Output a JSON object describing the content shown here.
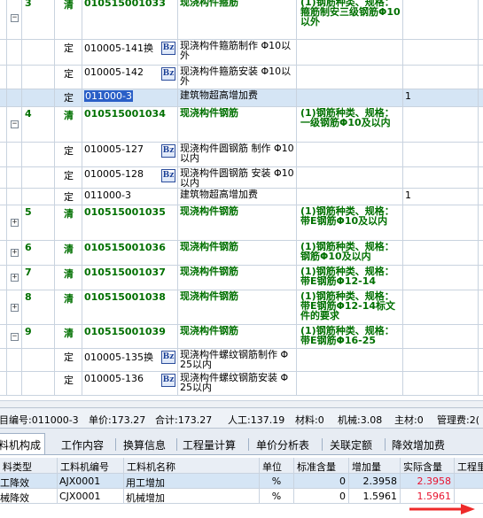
{
  "grid": {
    "rows": [
      {
        "type": "qing",
        "num": "3",
        "kind": "清",
        "code": "010515001033",
        "name": "现浇构件箍筋",
        "feature": "(1)钢筋种类、规格：箍筋制安三级钢筋Φ10以外",
        "qty": "",
        "toggle": "−"
      },
      {
        "type": "ding",
        "num": "",
        "kind": "定",
        "code": "010005-141换",
        "name": "现浇构件箍筋制作 Φ10以外",
        "feature": "",
        "qty": "",
        "bz": "Bz"
      },
      {
        "type": "ding",
        "num": "",
        "kind": "定",
        "code": "010005-142",
        "name": "现浇构件箍筋安装 Φ10以外",
        "feature": "",
        "qty": "",
        "bz": "Bz"
      },
      {
        "type": "ding",
        "num": "",
        "kind": "定",
        "code": "011000-3",
        "name": "建筑物超高增加费",
        "feature": "",
        "qty": "1",
        "selected": true
      },
      {
        "type": "qing",
        "num": "4",
        "kind": "清",
        "code": "010515001034",
        "name": "现浇构件钢筋",
        "feature": "(1)钢筋种类、规格：一级钢筋Φ10及以内",
        "qty": "",
        "toggle": "−"
      },
      {
        "type": "ding",
        "num": "",
        "kind": "定",
        "code": "010005-127",
        "name": "现浇构件圆钢筋 制作 Φ10以内",
        "feature": "",
        "qty": "",
        "bz": "Bz"
      },
      {
        "type": "ding",
        "num": "",
        "kind": "定",
        "code": "010005-128",
        "name": "现浇构件圆钢筋 安装 Φ10以内",
        "feature": "",
        "qty": "",
        "bz": "Bz"
      },
      {
        "type": "ding",
        "num": "",
        "kind": "定",
        "code": "011000-3",
        "name": "建筑物超高增加费",
        "feature": "",
        "qty": "1"
      },
      {
        "type": "qing",
        "num": "5",
        "kind": "清",
        "code": "010515001035",
        "name": "现浇构件钢筋",
        "feature": "(1)钢筋种类、规格：带E钢筋Φ10及以内",
        "qty": "",
        "toggle": "+"
      },
      {
        "type": "qing",
        "num": "6",
        "kind": "清",
        "code": "010515001036",
        "name": "现浇构件钢筋",
        "feature": "(1)钢筋种类、规格：钢筋Φ10及以内",
        "qty": "",
        "toggle": "+"
      },
      {
        "type": "qing",
        "num": "7",
        "kind": "清",
        "code": "010515001037",
        "name": "现浇构件钢筋",
        "feature": "(1)钢筋种类、规格：带E钢筋Φ12-14",
        "qty": "",
        "toggle": "+"
      },
      {
        "type": "qing",
        "num": "8",
        "kind": "清",
        "code": "010515001038",
        "name": "现浇构件钢筋",
        "feature": "(1)钢筋种类、规格：带E钢筋Φ12-14标文件的要求",
        "qty": "",
        "toggle": "+"
      },
      {
        "type": "qing",
        "num": "9",
        "kind": "清",
        "code": "010515001039",
        "name": "现浇构件钢筋",
        "feature": "(1)钢筋种类、规格：带E钢筋Φ16-25",
        "qty": "",
        "toggle": "−"
      },
      {
        "type": "ding",
        "num": "",
        "kind": "定",
        "code": "010005-135换",
        "name": "现浇构件螺纹钢筋制作 Φ25以内",
        "feature": "",
        "qty": "",
        "bz": "Bz"
      },
      {
        "type": "ding",
        "num": "",
        "kind": "定",
        "code": "010005-136",
        "name": "现浇构件螺纹钢筋安装 Φ25以内",
        "feature": "",
        "qty": "",
        "bz": "Bz"
      }
    ]
  },
  "summary": {
    "code": "目编号:011000-3",
    "unit_price": "单价:173.27",
    "total": "合计:173.27",
    "labor": "人工:137.19",
    "material": "材料:0",
    "machine": "机械:3.08",
    "main_material": "主材:0",
    "mgmt": "管理费:2("
  },
  "tabs": [
    "料机构成",
    "工作内容",
    "换算信息",
    "工程量计算",
    "单价分析表",
    "关联定额",
    "降效增加费"
  ],
  "resources": {
    "headers": [
      "料类型",
      "工料机编号",
      "工料机名称",
      "单位",
      "标准含量",
      "增加量",
      "实际含量",
      "工程里"
    ],
    "rows": [
      {
        "type": "工降效",
        "code": "AJX0001",
        "name": "用工增加",
        "unit": "%",
        "std": "0",
        "add": "2.3958",
        "actual": "2.3958",
        "extra": ""
      },
      {
        "type": "械降效",
        "code": "CJX0001",
        "name": "机械增加",
        "unit": "%",
        "std": "0",
        "add": "1.5961",
        "actual": "1.5961",
        "extra": ""
      }
    ]
  },
  "colors": {
    "green": "#007000",
    "selected": "#d5e5f5",
    "highlight": "#2a5fc7",
    "red": "#e8132f"
  }
}
